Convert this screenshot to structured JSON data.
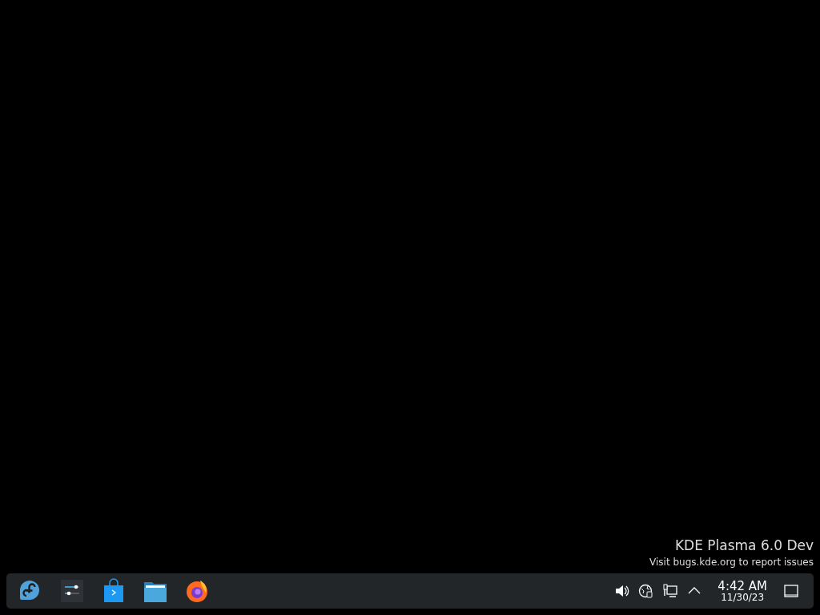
{
  "desktop_notice": {
    "title": "KDE Plasma 6.0 Dev",
    "subtitle": "Visit bugs.kde.org to report issues"
  },
  "panel": {
    "launchers": [
      {
        "kind": "menu"
      },
      {
        "kind": "settings"
      },
      {
        "kind": "store"
      },
      {
        "kind": "files"
      },
      {
        "kind": "browser"
      }
    ],
    "tray": [
      {
        "kind": "volume"
      },
      {
        "kind": "globe"
      },
      {
        "kind": "network"
      },
      {
        "kind": "expand"
      }
    ],
    "clock": {
      "time": "4:42 AM",
      "date": "11/30/23"
    }
  }
}
